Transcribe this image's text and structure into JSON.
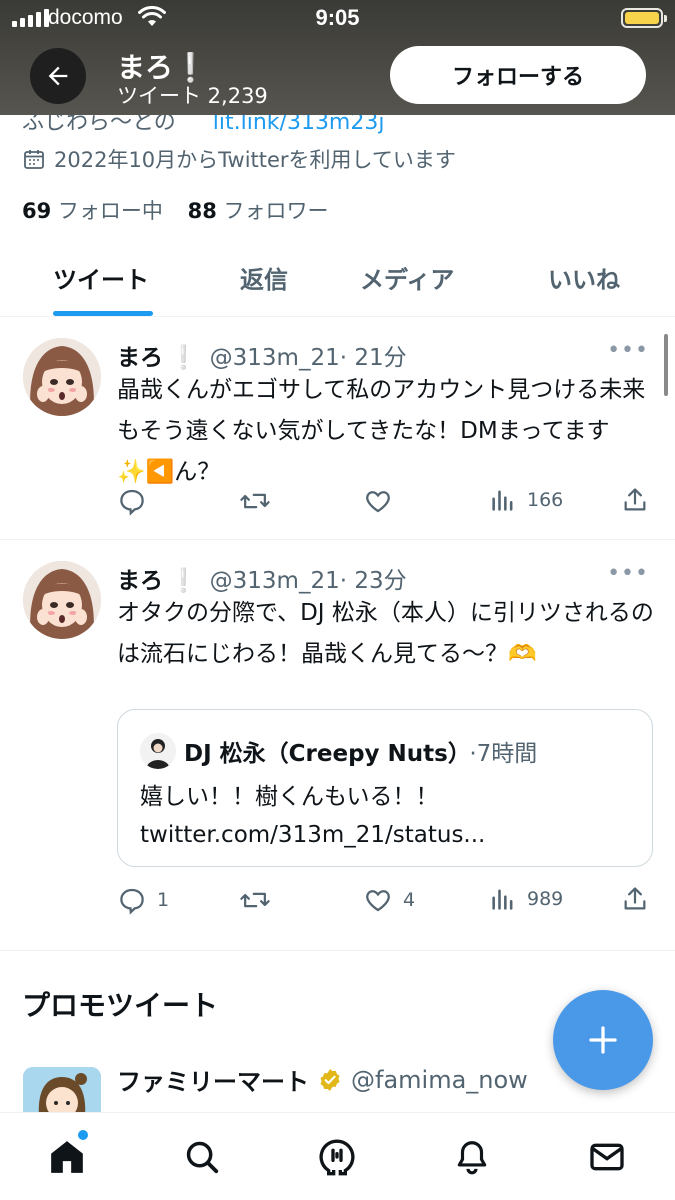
{
  "status_bar": {
    "carrier": "docomo",
    "time": "9:05"
  },
  "header": {
    "display_name": "まろ❕",
    "tweet_count_label": "ツイート 2,239",
    "follow_button_label": "フォローする"
  },
  "profile": {
    "partial_location": "ふじわら～との",
    "partial_link": "lit.link/313m23j",
    "joined": "2022年10月からTwitterを利用しています",
    "following_count": "69",
    "following_label": "フォロー中",
    "followers_count": "88",
    "followers_label": "フォロワー"
  },
  "tabs": [
    "ツイート",
    "返信",
    "メディア",
    "いいね"
  ],
  "tweets": [
    {
      "name": "まろ",
      "handle": "@313m_21",
      "time": "· 21分",
      "text": "晶哉くんがエゴサして私のアカウント見つける未来もそう遠くない気がしてきたな！DMまってます✨◀️ん？",
      "replies": "",
      "retweets": "",
      "likes": "",
      "views": "166"
    },
    {
      "name": "まろ",
      "handle": "@313m_21",
      "time": "· 23分",
      "text": "オタクの分際で、DJ 松永（本人）に引リツされるのは流石にじわる！晶哉くん見てる～？🫶",
      "replies": "1",
      "retweets": "",
      "likes": "4",
      "views": "989",
      "quote": {
        "name": "DJ 松永（Creepy Nuts）",
        "time": "·7時間",
        "text": "嬉しい！！樹くんもいる！！ twitter.com/313m_21/status..."
      }
    }
  ],
  "promoted": {
    "section_title": "プロモツイート",
    "name": "ファミリーマート",
    "handle": "@famima_now"
  },
  "colors": {
    "accent": "#1d9bf0",
    "fab": "#4a99e9",
    "verified_gold": "#e2b719"
  }
}
